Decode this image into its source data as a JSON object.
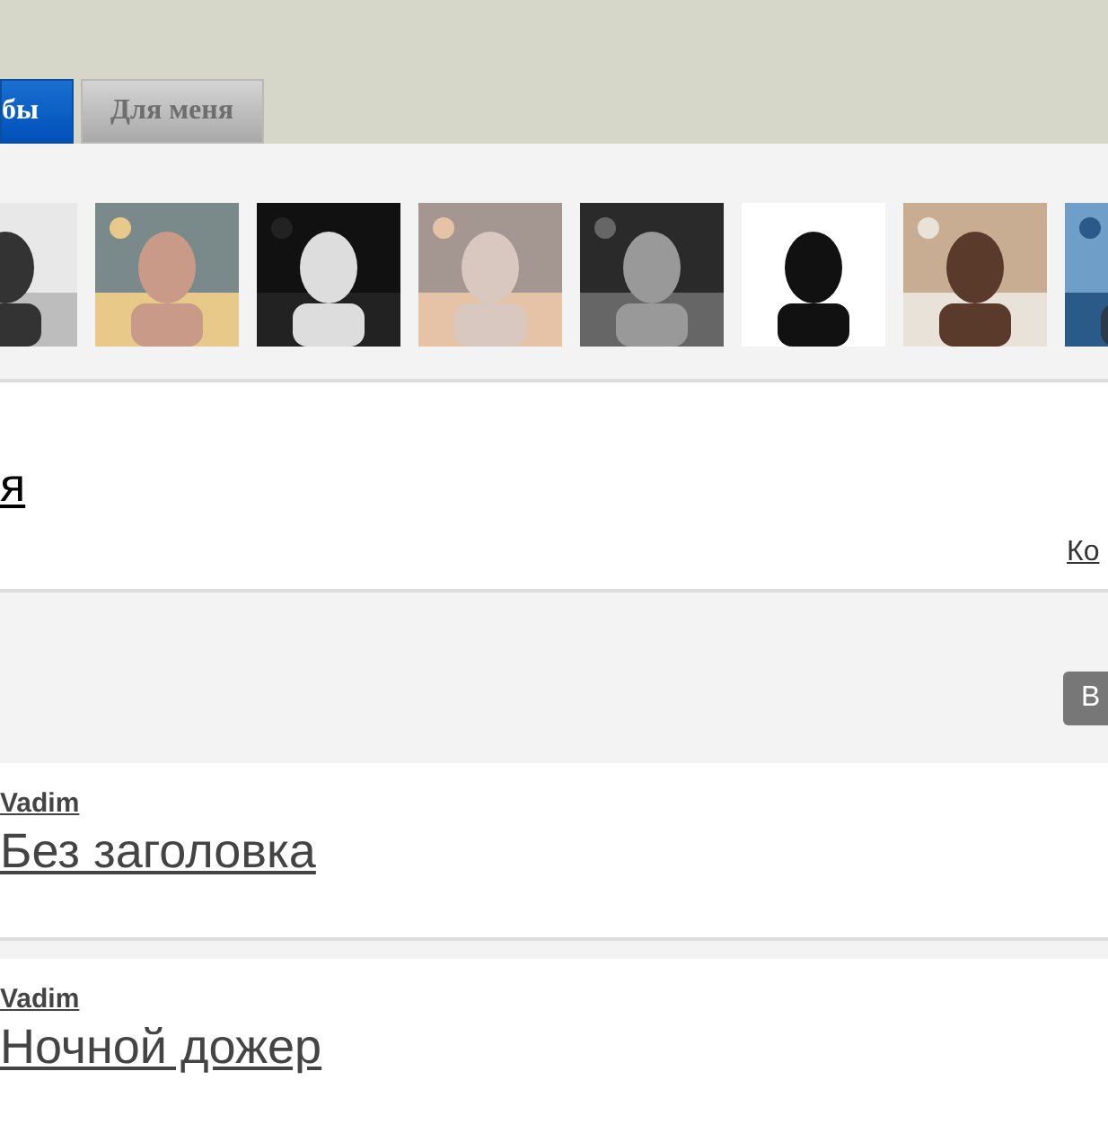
{
  "tabs": [
    {
      "label": "бы",
      "selected": true
    },
    {
      "label": "Для меня",
      "selected": false
    }
  ],
  "header": {
    "title": "я",
    "link": "Ко"
  },
  "toolbar": {
    "button": "В"
  },
  "posts": [
    {
      "author": "Vadim",
      "title": "Без заголовка"
    },
    {
      "author": "Vadim",
      "title": "Ночной дожер"
    }
  ]
}
